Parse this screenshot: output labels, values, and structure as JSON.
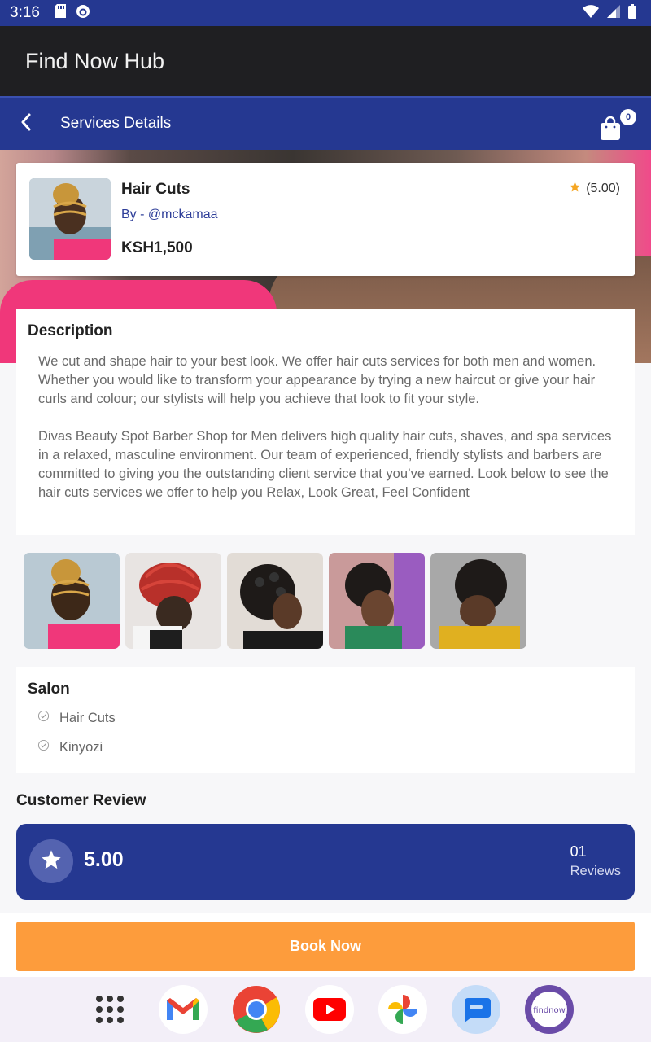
{
  "status_bar": {
    "time": "3:16"
  },
  "app": {
    "title": "Find Now Hub"
  },
  "nav": {
    "title": "Services Details",
    "cart_count": "0"
  },
  "service": {
    "name": "Hair Cuts",
    "by": "By - @mckamaa",
    "price": "KSH1,500",
    "rating": "(5.00)"
  },
  "description": {
    "title": "Description",
    "paragraphs": [
      "We cut and shape hair to your best look. We offer hair cuts services for both men and women. Whether you would like to transform your appearance by trying a new haircut or give your hair curls and colour; our stylists will help you achieve that look to fit your style.",
      "Divas Beauty Spot Barber Shop for Men delivers high quality hair cuts, shaves, and spa services in a relaxed, masculine environment. Our team of experienced, friendly stylists and barbers are committed to giving you the outstanding client service that you’ve earned. Look below to see the hair cuts services we offer to help you Relax, Look Great, Feel Confident"
    ]
  },
  "salon": {
    "title": "Salon",
    "items": [
      "Hair Cuts",
      "Kinyozi"
    ]
  },
  "reviews": {
    "heading": "Customer Review",
    "score": "5.00",
    "count": "01",
    "count_label": "Reviews"
  },
  "actions": {
    "book_label": "Book Now"
  },
  "colors": {
    "primary": "#253891",
    "accent": "#fd9c3c",
    "header_dark": "#1f1f22",
    "star": "#f5a623"
  },
  "dock": {
    "apps": [
      "app-drawer-icon",
      "gmail-icon",
      "chrome-icon",
      "youtube-icon",
      "photos-icon",
      "messages-icon",
      "findnow-app-icon"
    ]
  }
}
